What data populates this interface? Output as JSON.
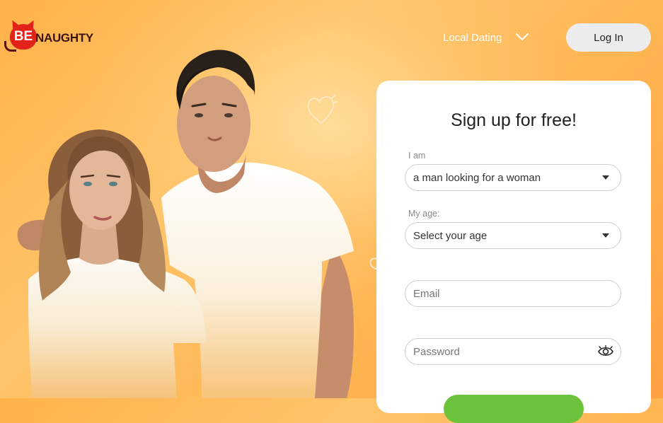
{
  "brand": {
    "logo_be": "BE",
    "logo_naughty": "NAUGHTY"
  },
  "header": {
    "nav_label": "Local Dating",
    "login_label": "Log In"
  },
  "signup": {
    "title": "Sign up for free!",
    "iam_label": "I am",
    "iam_value": "a man looking for a woman",
    "age_label": "My age:",
    "age_placeholder": "Select your age",
    "email_placeholder": "Email",
    "password_placeholder": "Password"
  },
  "colors": {
    "brand_red": "#e2231a",
    "accent_orange": "#ffb24a",
    "submit_green": "#6cc23a"
  },
  "icons": [
    "chevron-down-icon",
    "caret-down-icon",
    "eye-icon",
    "heart-outline-icon"
  ]
}
